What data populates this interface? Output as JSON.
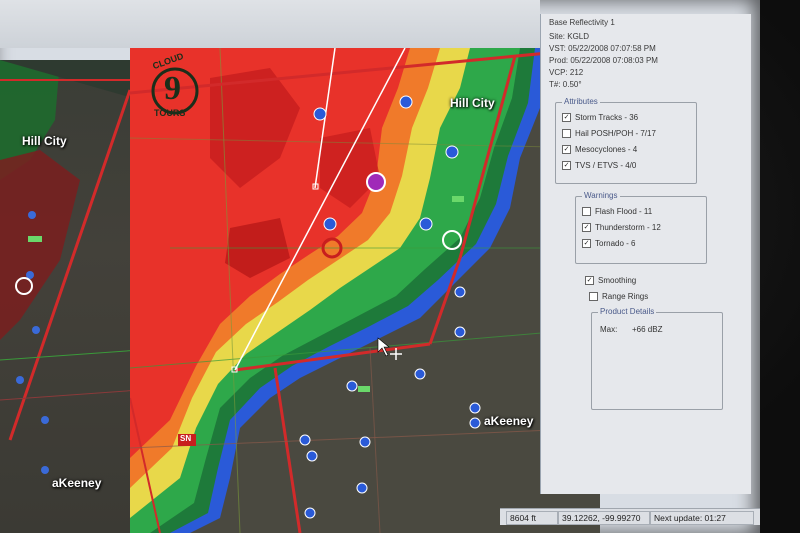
{
  "panel": {
    "product_title": "Base Reflectivity 1",
    "site": "Site:  KGLD",
    "vst": "VST:  05/22/2008  07:07:58 PM",
    "prod": "Prod:  05/22/2008  07:08:03 PM",
    "vcp": "VCP:  212",
    "tilt": "T#:  0.50°",
    "attributes": {
      "title": "Attributes",
      "items": [
        {
          "label": "Storm Tracks - 36",
          "checked": true
        },
        {
          "label": "Hail POSH/POH - 7/17",
          "checked": false
        },
        {
          "label": "Mesocyclones - 4",
          "checked": true
        },
        {
          "label": "TVS / ETVS - 4/0",
          "checked": true
        }
      ]
    },
    "warnings": {
      "title": "Warnings",
      "items": [
        {
          "label": "Flash Flood - 11",
          "checked": false
        },
        {
          "label": "Thunderstorm - 12",
          "checked": true
        },
        {
          "label": "Tornado - 6",
          "checked": true
        }
      ]
    },
    "smoothing": {
      "label": "Smoothing",
      "checked": true
    },
    "range_rings": {
      "label": "Range Rings",
      "checked": false
    },
    "product_details": {
      "title": "Product Details",
      "max_label": "Max:",
      "max_value": "+66 dBZ"
    }
  },
  "map": {
    "labels": {
      "left_hill_city": "Hill City",
      "main_hill_city": "Hill City",
      "left_wakeeney": "aKeeney",
      "main_wakeeney": "aKeeney"
    },
    "logo_text_top": "CLOUD",
    "logo_number": "9",
    "logo_text_bottom": "TOURS",
    "badge_text": "SN"
  },
  "statusbar": {
    "range": "8604 ft",
    "coords": "39.12262, -99.99270",
    "next_update": "Next update: 01:27"
  },
  "colors": {
    "red_core": "#e8322a",
    "orange": "#f07a2a",
    "yellow": "#e8d84a",
    "green": "#2ea84a",
    "dark_green": "#1e7a3a",
    "blue": "#2a6ae8",
    "county_line": "#d22a2a"
  }
}
